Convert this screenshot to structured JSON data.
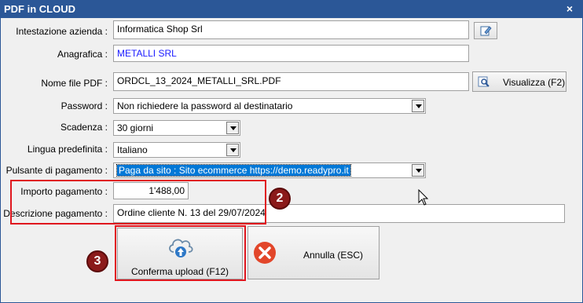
{
  "window": {
    "title": "PDF in CLOUD",
    "close_symbol": "×"
  },
  "form": {
    "intestazione": {
      "label": "Intestazione azienda :",
      "value": "Informatica Shop Srl"
    },
    "anagrafica": {
      "label": "Anagrafica :",
      "value": "METALLI SRL"
    },
    "nome_file": {
      "label": "Nome file PDF :",
      "value": "ORDCL_13_2024_METALLI_SRL.PDF",
      "view_button": "Visualizza (F2)"
    },
    "password": {
      "label": "Password :",
      "value": "Non richiedere la password al destinatario"
    },
    "scadenza": {
      "label": "Scadenza :",
      "value": "30 giorni"
    },
    "lingua": {
      "label": "Lingua predefinita :",
      "value": "Italiano"
    },
    "pulsante": {
      "label": "Pulsante di pagamento :",
      "value": "Paga da sito : Sito ecommerce https://demo.readypro.it"
    },
    "importo": {
      "label": "Importo pagamento :",
      "value": "1'488,00"
    },
    "descrizione": {
      "label": "Descrizione pagamento :",
      "value": "Ordine cliente N. 13 del 29/07/2024"
    }
  },
  "buttons": {
    "confirm": "Conferma upload (F12)",
    "cancel": "Annulla (ESC)"
  },
  "badges": {
    "b2": "2",
    "b3": "3"
  },
  "colors": {
    "titlebar": "#2b5797",
    "highlight_box": "#e0161e",
    "badge": "#8b1a1a",
    "selection": "#0078d7"
  }
}
